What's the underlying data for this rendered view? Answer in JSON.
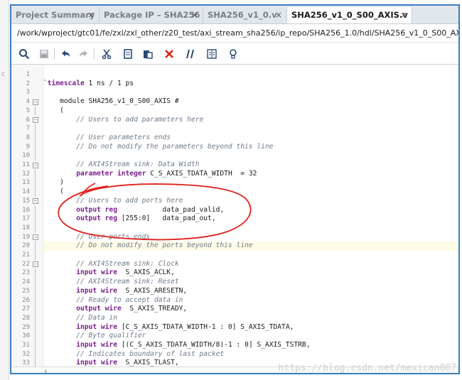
{
  "tabs": [
    {
      "label": "Project Summary",
      "close": "×"
    },
    {
      "label": "Package IP – SHA256",
      "close": "×"
    },
    {
      "label": "SHA256_v1_0.v",
      "close": "×"
    },
    {
      "label": "SHA256_v1_0_S00_AXIS.v",
      "close": "×",
      "active": true
    }
  ],
  "path": "/work/wproject/gtc01/fe/zxl/zxl_other/z20_test/axi_stream_sha256/ip_repo/SHA256_1.0/hdl/SHA256_v1_0_S00_AXIS.v",
  "toolbar": {
    "icons": [
      "search-icon",
      "save-icon",
      "undo-icon",
      "redo-icon",
      "cut-icon",
      "copy-icon",
      "paste-icon",
      "delete-icon",
      "comment-icon",
      "indent-icon",
      "bulb-icon"
    ]
  },
  "editor": {
    "highlight_line": 20,
    "folds": [
      "4",
      "6",
      "11",
      "15",
      "19",
      "22"
    ],
    "lines": [
      {
        "n": "1",
        "t": ""
      },
      {
        "n": "2",
        "t": "`timescale 1 ns / 1 ps"
      },
      {
        "n": "3",
        "t": ""
      },
      {
        "n": "4",
        "t": "    module SHA256_v1_0_S00_AXIS #"
      },
      {
        "n": "5",
        "t": "    ("
      },
      {
        "n": "6",
        "t": "        // Users to add parameters here"
      },
      {
        "n": "7",
        "t": ""
      },
      {
        "n": "8",
        "t": "        // User parameters ends"
      },
      {
        "n": "9",
        "t": "        // Do not modify the parameters beyond this line"
      },
      {
        "n": "10",
        "t": ""
      },
      {
        "n": "11",
        "t": "        // AXI4Stream sink: Data Width"
      },
      {
        "n": "12",
        "t": "        parameter integer C_S_AXIS_TDATA_WIDTH  = 32"
      },
      {
        "n": "13",
        "t": "    )"
      },
      {
        "n": "14",
        "t": "    ("
      },
      {
        "n": "15",
        "t": "        // Users to add ports here"
      },
      {
        "n": "16",
        "t": "        output reg           data_pad_valid,"
      },
      {
        "n": "17",
        "t": "        output reg [255:0]   data_pad_out,"
      },
      {
        "n": "18",
        "t": ""
      },
      {
        "n": "19",
        "t": "        // User ports ends"
      },
      {
        "n": "20",
        "t": "        // Do not modify the ports beyond this line"
      },
      {
        "n": "21",
        "t": ""
      },
      {
        "n": "22",
        "t": "        // AXI4Stream sink: Clock"
      },
      {
        "n": "23",
        "t": "        input wire  S_AXIS_ACLK,"
      },
      {
        "n": "24",
        "t": "        // AXI4Stream sink: Reset"
      },
      {
        "n": "25",
        "t": "        input wire  S_AXIS_ARESETN,"
      },
      {
        "n": "26",
        "t": "        // Ready to accept data in"
      },
      {
        "n": "27",
        "t": "        output wire  S_AXIS_TREADY,"
      },
      {
        "n": "28",
        "t": "        // Data in"
      },
      {
        "n": "29",
        "t": "        input wire [C_S_AXIS_TDATA_WIDTH-1 : 0] S_AXIS_TDATA,"
      },
      {
        "n": "30",
        "t": "        // Byte qualifier"
      },
      {
        "n": "31",
        "t": "        input wire [(C_S_AXIS_TDATA_WIDTH/8)-1 : 0] S_AXIS_TSTRB,"
      },
      {
        "n": "32",
        "t": "        // Indicates boundary of last packet"
      },
      {
        "n": "33",
        "t": "        input wire  S_AXIS_TLAST,"
      }
    ]
  },
  "scroll_left": "‹",
  "watermark": "https://blog.csdn.net/mexican007",
  "colors": {
    "frame": "#3d7cc0",
    "keyword": "#7b2090",
    "comment": "#6e7b8a",
    "annotation": "#e0201b"
  }
}
